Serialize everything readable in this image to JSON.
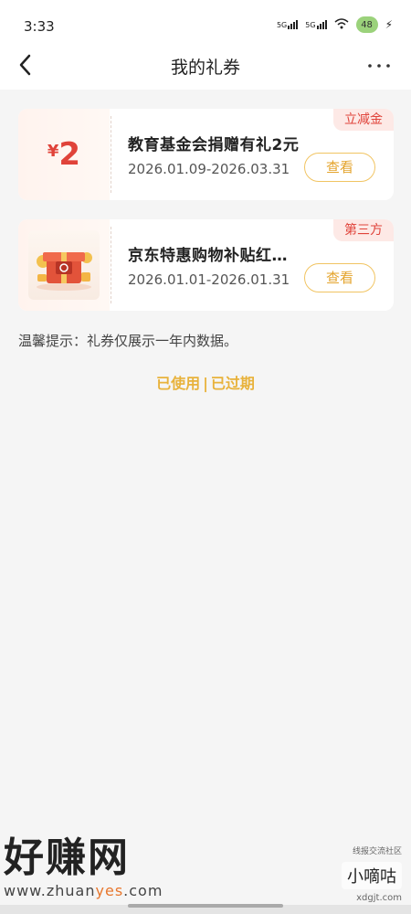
{
  "status": {
    "time": "3:33",
    "net1": "5G",
    "net2": "5G",
    "battery": "48"
  },
  "header": {
    "title": "我的礼券"
  },
  "coupons": [
    {
      "amount_symbol": "¥",
      "amount": "2",
      "title": "教育基金会捐赠有礼2元",
      "date": "2026.01.09-2026.03.31",
      "badge": "立减金",
      "action": "查看"
    },
    {
      "title": "京东特惠购物补贴红…",
      "date": "2026.01.01-2026.01.31",
      "badge": "第三方",
      "action": "查看",
      "image": "gift-box-image"
    }
  ],
  "tip": "温馨提示：礼券仅展示一年内数据。",
  "history": {
    "used": "已使用",
    "separator": "|",
    "expired": "已过期"
  },
  "watermark": {
    "brand": "好赚网",
    "url_prefix": "www.zhuan",
    "url_mid": "yes",
    "url_suffix": ".com",
    "right_small": "线报交流社区",
    "right_box": "小嘀咕",
    "right_domain": "xdgjt.com"
  },
  "colors": {
    "accent_red": "#e0433a",
    "accent_gold": "#e8b23b"
  }
}
